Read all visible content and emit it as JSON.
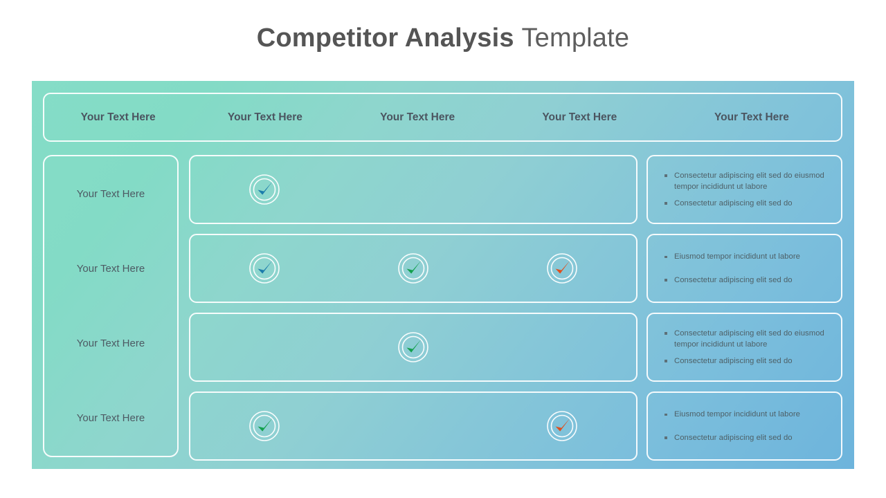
{
  "title": {
    "bold_part": "Competitor Analysis",
    "light_part": "Template"
  },
  "colors": {
    "gradient_start": "#85ddc7",
    "gradient_end": "#6db4dc",
    "title_text": "#575757",
    "header_text": "#4b5560",
    "body_text": "#4e6067",
    "border": "#ffffff",
    "check_blue": "#1b7cab",
    "check_green": "#13a04d",
    "check_orange": "#de4f1e"
  },
  "header": {
    "cells": [
      {
        "label": "Your Text Here"
      },
      {
        "label": "Your Text Here"
      },
      {
        "label": "Your Text Here"
      },
      {
        "label": "Your Text Here"
      },
      {
        "label": "Your Text Here"
      }
    ]
  },
  "left_column": {
    "rows": [
      {
        "label": "Your Text Here"
      },
      {
        "label": "Your Text Here"
      },
      {
        "label": "Your Text Here"
      },
      {
        "label": "Your Text Here"
      }
    ]
  },
  "check_rows": [
    {
      "row_index": 0,
      "slots": [
        {
          "state": "check",
          "color": "#1b7cab",
          "icon": "check-circle-icon"
        },
        {
          "state": "empty",
          "color": null,
          "icon": null
        },
        {
          "state": "empty",
          "color": null,
          "icon": null
        }
      ]
    },
    {
      "row_index": 1,
      "slots": [
        {
          "state": "check",
          "color": "#1b7cab",
          "icon": "check-circle-icon"
        },
        {
          "state": "check",
          "color": "#13a04d",
          "icon": "check-circle-icon"
        },
        {
          "state": "check",
          "color": "#de4f1e",
          "icon": "check-circle-icon"
        }
      ]
    },
    {
      "row_index": 2,
      "slots": [
        {
          "state": "empty",
          "color": null,
          "icon": null
        },
        {
          "state": "check",
          "color": "#13a04d",
          "icon": "check-circle-icon"
        },
        {
          "state": "empty",
          "color": null,
          "icon": null
        }
      ]
    },
    {
      "row_index": 3,
      "slots": [
        {
          "state": "check",
          "color": "#13a04d",
          "icon": "check-circle-icon"
        },
        {
          "state": "empty",
          "color": null,
          "icon": null
        },
        {
          "state": "check",
          "color": "#de4f1e",
          "icon": "check-circle-icon"
        }
      ]
    }
  ],
  "bullet_cards": [
    {
      "card_index": 0,
      "spaced": false,
      "bullets": [
        "Consectetur adipiscing elit sed do eiusmod tempor incididunt ut labore",
        "Consectetur adipiscing elit sed do"
      ]
    },
    {
      "card_index": 1,
      "spaced": true,
      "bullets": [
        "Eiusmod tempor incididunt ut labore",
        "Consectetur adipiscing elit sed do"
      ]
    },
    {
      "card_index": 2,
      "spaced": false,
      "bullets": [
        "Consectetur adipiscing elit sed do eiusmod tempor incididunt ut labore",
        "Consectetur adipiscing elit sed do"
      ]
    },
    {
      "card_index": 3,
      "spaced": true,
      "bullets": [
        "Eiusmod tempor incididunt ut labore",
        "Consectetur adipiscing elit sed do"
      ]
    }
  ]
}
